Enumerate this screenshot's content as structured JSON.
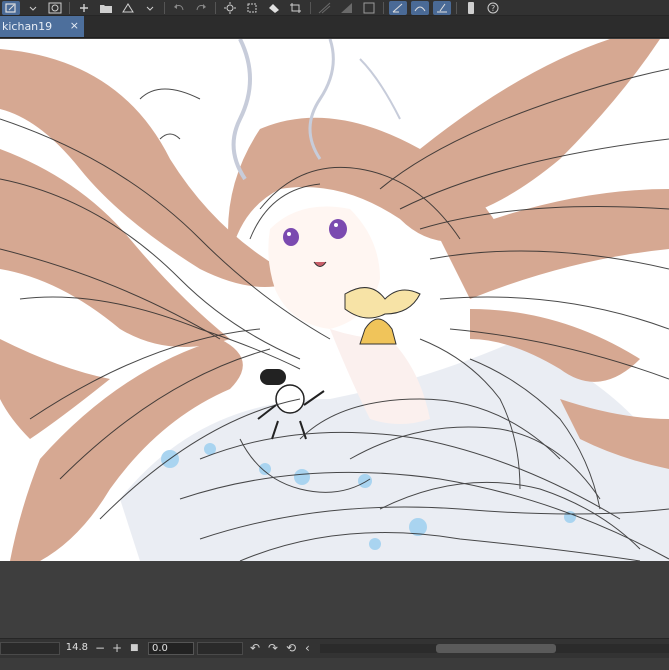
{
  "document": {
    "tab_title": "kichan19",
    "close_glyph": "×"
  },
  "toolbar": {
    "icons": [
      "new-layer-icon",
      "spiral-icon",
      "add-icon",
      "folder-icon",
      "fill-icon",
      "undo-icon",
      "redo-icon",
      "sun-icon",
      "transform-icon",
      "eraser-icon",
      "crop-icon",
      "mirror-icon",
      "snap-ruler-icon",
      "snap-special-icon",
      "snap-grid-icon",
      "phone-icon",
      "help-icon"
    ]
  },
  "status": {
    "zoom_value": "14.8",
    "minus_glyph": "−",
    "plus_glyph": "+",
    "stop_glyph": "■",
    "angle_value": "0.0",
    "rotate_left_glyph": "↶",
    "rotate_right_glyph": "↷",
    "reset_glyph": "⟲",
    "back_glyph": "‹"
  },
  "colors": {
    "hair": "#d4a58f",
    "sketch": "#2b2b2b",
    "eyes": "#7b4ab0",
    "bell": "#f0c45a",
    "dress": "#e3e7ef",
    "dots": "#a9d4f0",
    "accent_tab": "#4d6f9c"
  }
}
